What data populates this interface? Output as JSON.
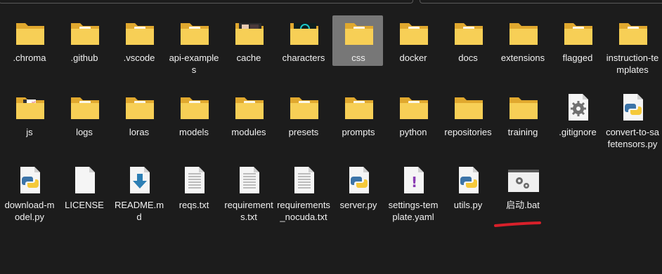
{
  "items": [
    {
      "label": ".chroma",
      "type": "folder",
      "overlay": "none"
    },
    {
      "label": ".github",
      "type": "folder",
      "overlay": "doc"
    },
    {
      "label": ".vscode",
      "type": "folder",
      "overlay": "doc"
    },
    {
      "label": "api-examples",
      "type": "folder",
      "overlay": "doc"
    },
    {
      "label": "cache",
      "type": "folder",
      "overlay": "photo"
    },
    {
      "label": "characters",
      "type": "folder",
      "overlay": "photo-dark"
    },
    {
      "label": "css",
      "type": "folder",
      "overlay": "doc",
      "selected": true
    },
    {
      "label": "docker",
      "type": "folder",
      "overlay": "doc"
    },
    {
      "label": "docs",
      "type": "folder",
      "overlay": "doc"
    },
    {
      "label": "extensions",
      "type": "folder",
      "overlay": "none"
    },
    {
      "label": "flagged",
      "type": "folder",
      "overlay": "doc"
    },
    {
      "label": "instruction-templates",
      "type": "folder",
      "overlay": "doc"
    },
    {
      "label": "js",
      "type": "folder",
      "overlay": "js"
    },
    {
      "label": "logs",
      "type": "folder",
      "overlay": "doc"
    },
    {
      "label": "loras",
      "type": "folder",
      "overlay": "doc"
    },
    {
      "label": "models",
      "type": "folder",
      "overlay": "doc"
    },
    {
      "label": "modules",
      "type": "folder",
      "overlay": "doc"
    },
    {
      "label": "presets",
      "type": "folder",
      "overlay": "doc"
    },
    {
      "label": "prompts",
      "type": "folder",
      "overlay": "doc"
    },
    {
      "label": "python",
      "type": "folder",
      "overlay": "doc"
    },
    {
      "label": "repositories",
      "type": "folder",
      "overlay": "none"
    },
    {
      "label": "training",
      "type": "folder",
      "overlay": "none"
    },
    {
      "label": ".gitignore",
      "type": "gear-file"
    },
    {
      "label": "convert-to-safetensors.py",
      "type": "python-file"
    },
    {
      "label": "download-model.py",
      "type": "python-file"
    },
    {
      "label": "LICENSE",
      "type": "blank-file"
    },
    {
      "label": "README.md",
      "type": "download-file"
    },
    {
      "label": "reqs.txt",
      "type": "text-file"
    },
    {
      "label": "requirements.txt",
      "type": "text-file"
    },
    {
      "label": "requirements_nocuda.txt",
      "type": "text-file"
    },
    {
      "label": "server.py",
      "type": "python-file"
    },
    {
      "label": "settings-template.yaml",
      "type": "yaml-file"
    },
    {
      "label": "utils.py",
      "type": "python-file"
    },
    {
      "label": "启动.bat",
      "type": "bat-file"
    }
  ],
  "colors": {
    "background": "#1c1c1c",
    "folder_back": "#e0a82e",
    "folder_front": "#f7cf56",
    "selection": "#777777",
    "annotation": "#d8202a"
  }
}
